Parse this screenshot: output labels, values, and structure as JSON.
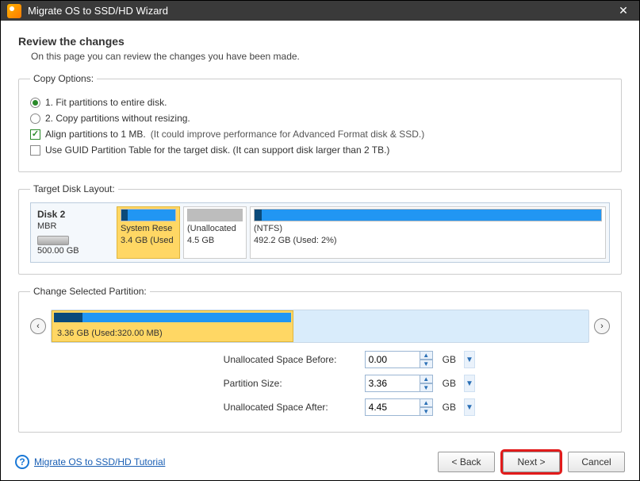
{
  "window": {
    "title": "Migrate OS to SSD/HD Wizard"
  },
  "header": {
    "title": "Review the changes",
    "desc": "On this page you can review the changes you have been made."
  },
  "copyOptions": {
    "legend": "Copy Options:",
    "opt1": "1. Fit partitions to entire disk.",
    "opt2": "2. Copy partitions without resizing.",
    "alignLabel": "Align partitions to 1 MB.",
    "alignHint": "(It could improve performance for Advanced Format disk & SSD.)",
    "guidLabel": "Use GUID Partition Table for the target disk. (It can support disk larger than 2 TB.)"
  },
  "targetDisk": {
    "legend": "Target Disk Layout:",
    "diskName": "Disk 2",
    "scheme": "MBR",
    "size": "500.00 GB",
    "p1": {
      "name": "System Rese",
      "size": "3.4 GB (Used"
    },
    "p2": {
      "name": "(Unallocated",
      "size": "4.5 GB"
    },
    "p3": {
      "name": "(NTFS)",
      "size": "492.2 GB (Used: 2%)"
    }
  },
  "change": {
    "legend": "Change Selected Partition:",
    "barLabel": "3.36 GB (Used:320.00 MB)",
    "rows": {
      "beforeLabel": "Unallocated Space Before:",
      "beforeVal": "0.00",
      "sizeLabel": "Partition Size:",
      "sizeVal": "3.36",
      "afterLabel": "Unallocated Space After:",
      "afterVal": "4.45",
      "unit": "GB"
    }
  },
  "footer": {
    "tutorial": "Migrate OS to SSD/HD Tutorial",
    "back": "< Back",
    "next": "Next >",
    "cancel": "Cancel"
  }
}
